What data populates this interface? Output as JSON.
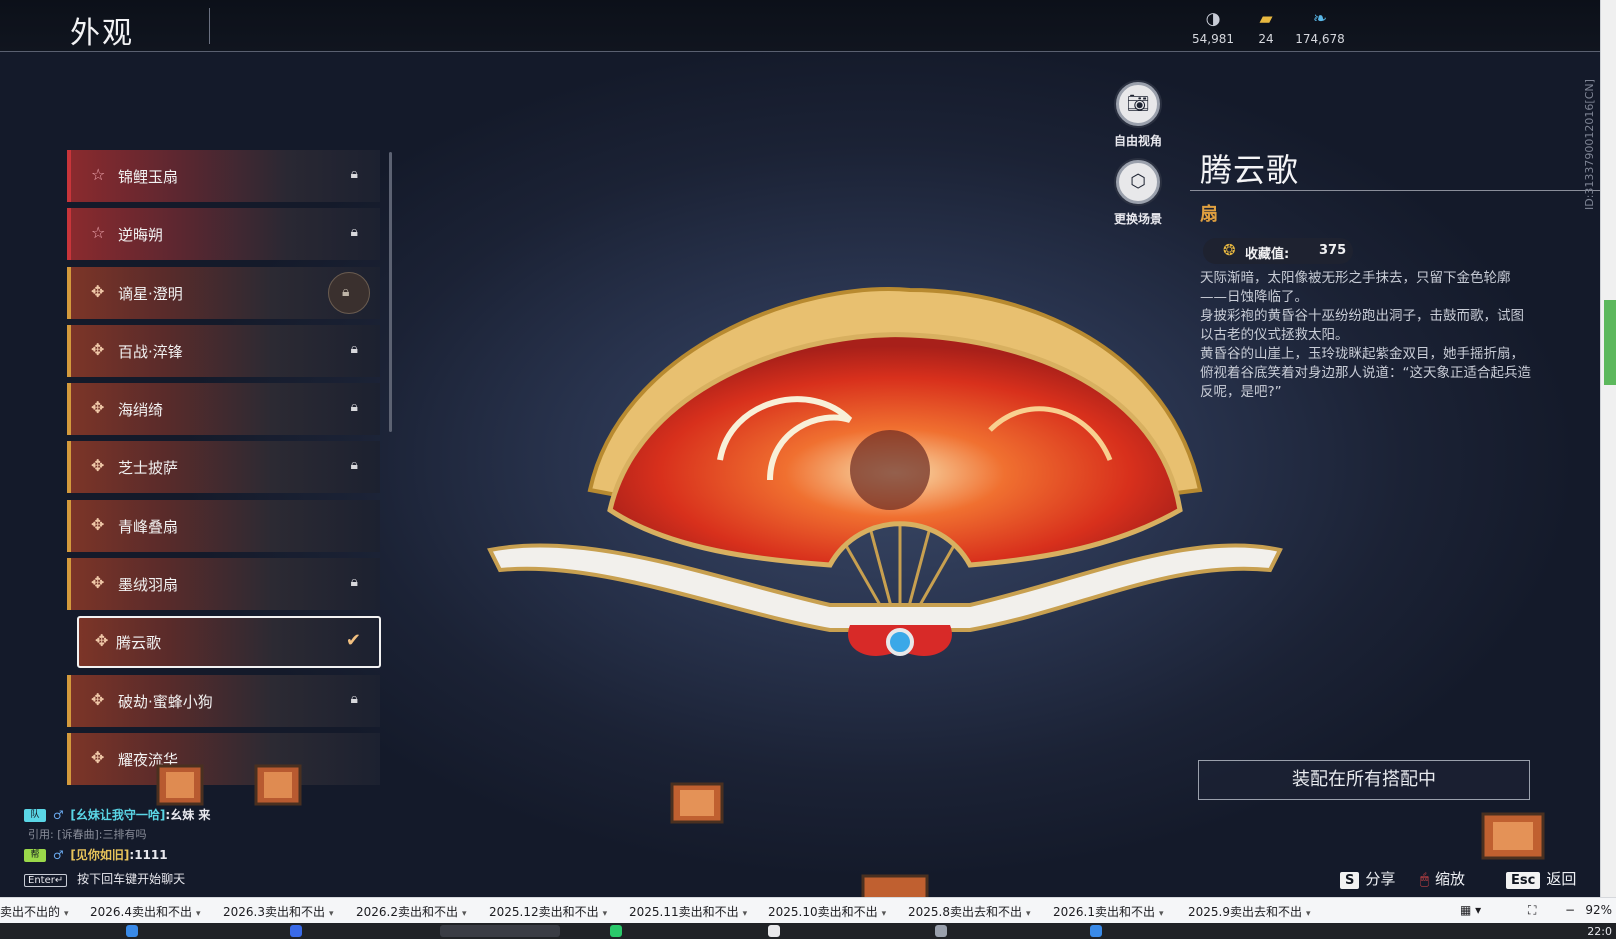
{
  "header": {
    "title": "外观",
    "currencies": [
      {
        "icon": "moon-coin-icon",
        "value": "54,981"
      },
      {
        "icon": "crate-icon",
        "value": "24"
      },
      {
        "icon": "feather-icon",
        "value": "174,678"
      }
    ]
  },
  "list": {
    "items": [
      {
        "label": "锦鲤玉扇",
        "kind": "star",
        "status": "locked"
      },
      {
        "label": "逆晦朔",
        "kind": "star",
        "status": "locked"
      },
      {
        "label": "谪星·澄明",
        "kind": "cross",
        "status": "special-locked"
      },
      {
        "label": "百战·淬锋",
        "kind": "cross",
        "status": "locked"
      },
      {
        "label": "海绡绮",
        "kind": "cross",
        "status": "locked"
      },
      {
        "label": "芝士披萨",
        "kind": "cross",
        "status": "locked"
      },
      {
        "label": "青峰叠扇",
        "kind": "cross",
        "status": "none"
      },
      {
        "label": "墨绒羽扇",
        "kind": "cross",
        "status": "locked"
      },
      {
        "label": "腾云歌",
        "kind": "cross",
        "status": "selected"
      },
      {
        "label": "破劫·蜜蜂小狗",
        "kind": "cross",
        "status": "locked"
      },
      {
        "label": "耀夜流华",
        "kind": "cross",
        "status": "none"
      }
    ]
  },
  "camera": {
    "free_view": "自由视角",
    "change_scene": "更换场景"
  },
  "detail": {
    "name": "腾云歌",
    "type": "扇",
    "collect_label": "收藏值:",
    "collect_value": "375",
    "description": [
      "天际渐暗，太阳像被无形之手抹去，只留下金色轮廓——日蚀降临了。",
      "身披彩袍的黄昏谷十巫纷纷跑出洞子，击鼓而歌，试图以古老的仪式拯救太阳。",
      "黄昏谷的山崖上，玉玲珑眯起紫金双目，她手摇折扇，俯视着谷底笑着对身边那人说道：“这天象正适合起兵造反呢，是吧?”"
    ],
    "equip_button": "装配在所有搭配中",
    "vertical_id": "ID:3133790012016[CN]"
  },
  "chat": {
    "line1": {
      "channel": "队",
      "name": "[幺妹让我守一哈]",
      "message": ":幺妹 来"
    },
    "quote": "引用: [诉春曲]:三排有吗",
    "line2": {
      "channel": "帮",
      "name": "[见你如旧]",
      "message": ":1111"
    },
    "enter_key": "Enter↵",
    "hint": "按下回车键开始聊天"
  },
  "hints": {
    "share_key": "S",
    "share": "分享",
    "zoom": "缩放",
    "back_key": "Esc",
    "back": "返回"
  },
  "tabs": [
    "卖出不出的",
    "2026.4卖出和不出",
    "2026.3卖出和不出",
    "2026.2卖出和不出",
    "2025.12卖出和不出",
    "2025.11卖出和不出",
    "2025.10卖出和不出",
    "2025.8卖出去和不出",
    "2026.1卖出和不出",
    "2025.9卖出去和不出"
  ],
  "zoom_level": "92%",
  "clock": "22:0",
  "colors": {
    "accent": "#e0a040",
    "star_border": "#c8353a",
    "cross_border": "#d49a3c"
  }
}
